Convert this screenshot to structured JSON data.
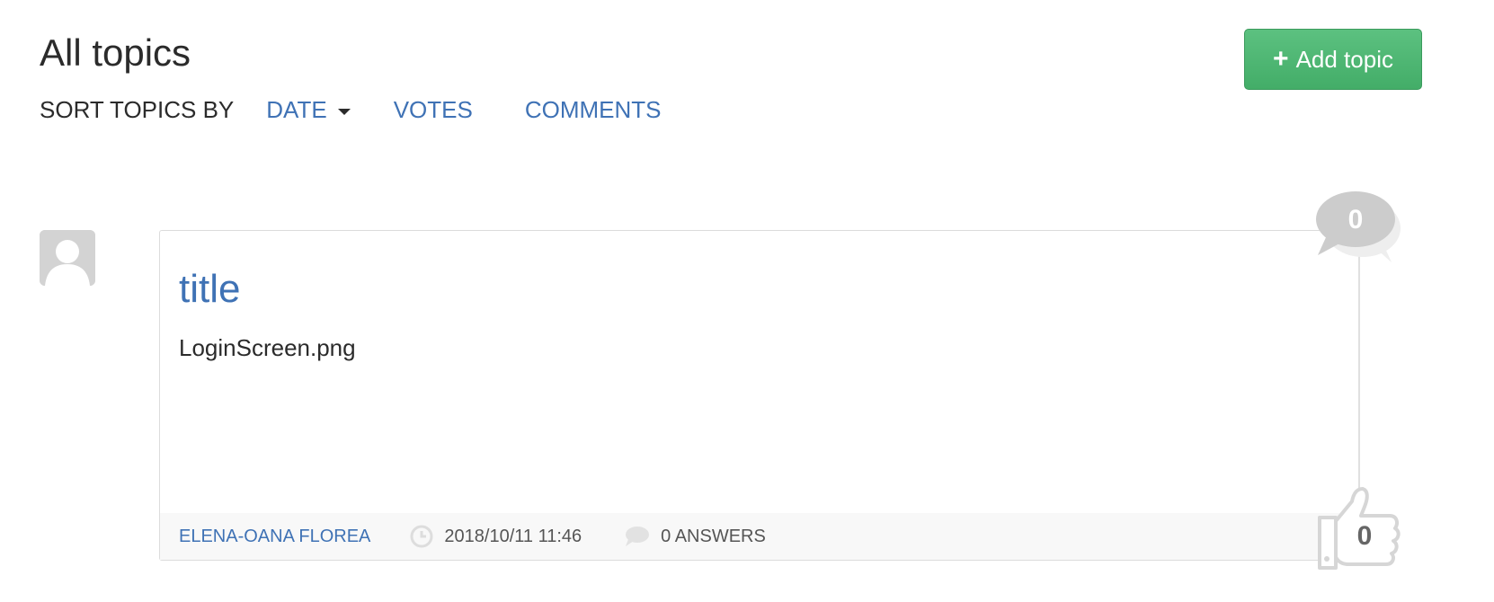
{
  "header": {
    "title": "All topics",
    "add_button_label": "Add topic",
    "add_button_color": "#4cb572"
  },
  "sort": {
    "label": "SORT TOPICS BY",
    "options": [
      {
        "label": "DATE",
        "active": true,
        "dropdown": true
      },
      {
        "label": "VOTES"
      },
      {
        "label": "COMMENTS"
      }
    ]
  },
  "topics": [
    {
      "title": "title",
      "body": "LoginScreen.png",
      "author": "ELENA-OANA FLOREA",
      "datetime": "2018/10/11 11:46",
      "answers": "0 ANSWERS",
      "comments_count": "0",
      "votes_count": "0"
    }
  ],
  "colors": {
    "link": "#3f72b5",
    "text": "#2b2b2b",
    "badge_gray": "#cccccc"
  },
  "icons": {
    "add": "plus-icon",
    "sort": "caret-down-icon",
    "avatar": "user-placeholder-icon",
    "time": "clock-icon",
    "answers": "speech-bubble-icon",
    "comments": "comments-bubble-icon",
    "votes": "thumbs-up-icon"
  }
}
